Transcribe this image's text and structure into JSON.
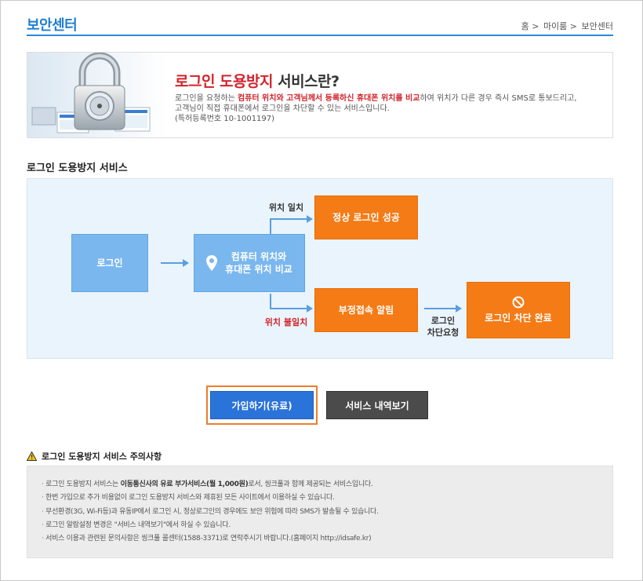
{
  "header": {
    "title": "보안센터",
    "breadcrumb": [
      "홈 >",
      "마이룸 >",
      "보안센터"
    ]
  },
  "banner": {
    "heading_red": "로그인 도용방지",
    "heading_rest": " 서비스란?",
    "line1_a": "로그인을 요청하는 ",
    "line1_red": "컴퓨터 위치와 고객님께서 등록하신 휴대폰 위치를 비교",
    "line1_b": "하여 위치가 다른 경우 즉시 SMS로 통보드리고,",
    "line2": "고객님이 직접 휴대폰에서 로그인을 차단할 수 있는 서비스입니다.",
    "line3": "(특허등록번호 10-1001197)"
  },
  "service": {
    "title": "로그인 도용방지 서비스",
    "flow": {
      "login": "로그인",
      "compare_1": "컴퓨터 위치와",
      "compare_2": "휴대폰 위치 비교",
      "match_label": "위치 일치",
      "success": "정상 로그인 성공",
      "mismatch_label": "위치 불일치",
      "alert": "부정접속 알림",
      "block_req_1": "로그인",
      "block_req_2": "차단요청",
      "blocked": "로그인 차단 완료"
    }
  },
  "buttons": {
    "join": "가입하기(유료)",
    "history": "서비스 내역보기"
  },
  "caution": {
    "title": "로그인 도용방지 서비스 주의사항",
    "item1_a": "로그인 도용방지 서비스는 ",
    "item1_b": "이동통신사의 유료 부가서비스(월 1,000원)",
    "item1_c": "로서, 씽크풀과 함께 제공되는 서비스입니다.",
    "item2": "한번 가입으로 추가 비용없이 로그인 도용방지 서비스와 제휴된 모든 사이트에서 이용하실 수 있습니다.",
    "item3": "무선환경(3G, Wi-Fi등)과 유동IP에서 로그인 시, 정상로그인의 경우에도 보안 위험에 따라 SMS가 발송될 수 있습니다.",
    "item4": "로그인 알람설정 변경은 \"서비스 내역보기\"에서 하실 수 있습니다.",
    "item5": "서비스 이용과 관련된 문의사항은 씽크풀 콜센터(1588-3371)로 연락주시기 바랍니다.(홈페이지 http://idsafe.kr)"
  },
  "colors": {
    "accent_blue": "#1f7fd1",
    "flow_blue": "#7ab7ee",
    "flow_orange": "#f47b16",
    "warning_red": "#d3232a",
    "join_button": "#2a73d9",
    "highlight_border": "#ef7d2c"
  }
}
